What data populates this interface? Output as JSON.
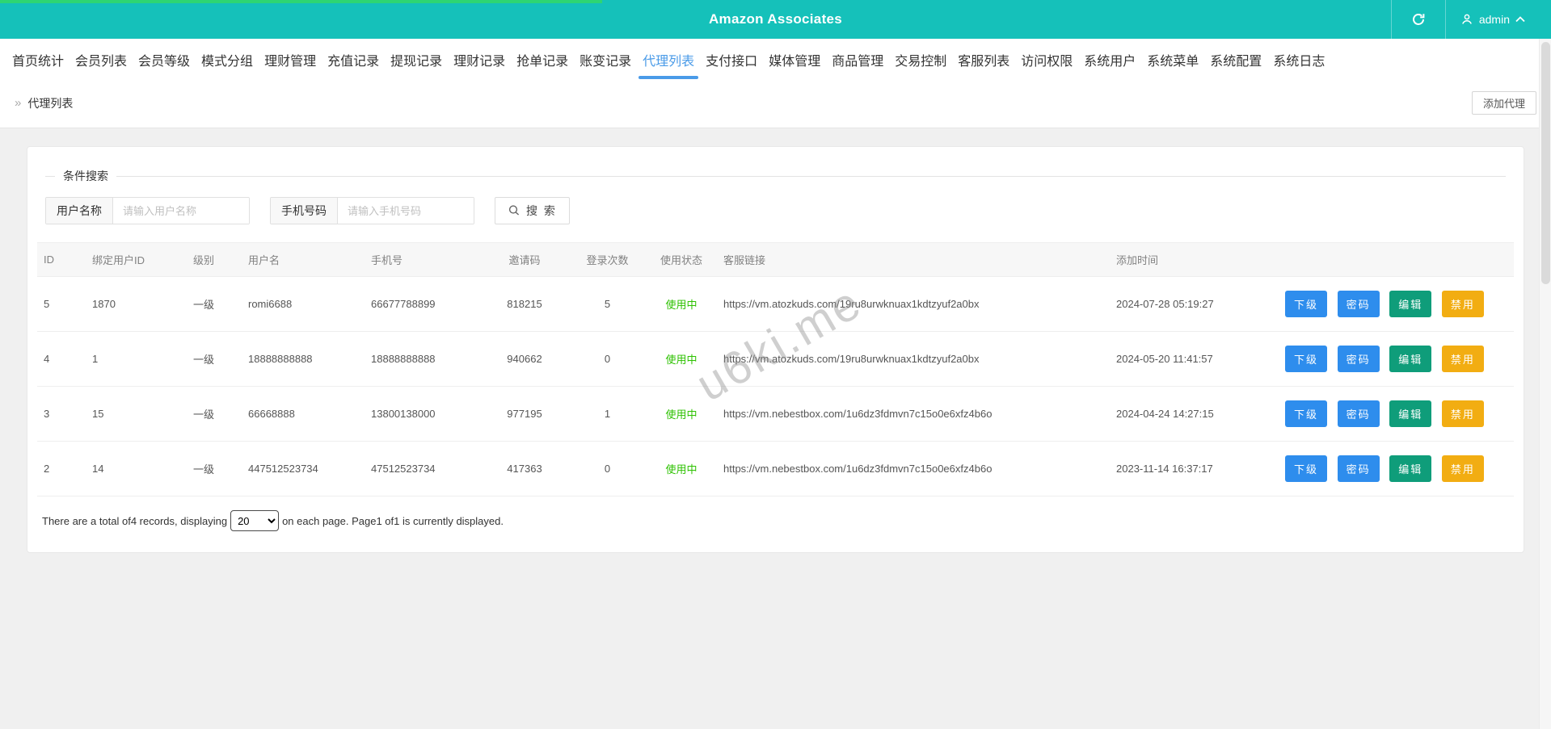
{
  "header": {
    "title": "Amazon Associates",
    "user": "admin"
  },
  "nav": {
    "items": [
      {
        "label": "首页统计",
        "active": false
      },
      {
        "label": "会员列表",
        "active": false
      },
      {
        "label": "会员等级",
        "active": false
      },
      {
        "label": "模式分组",
        "active": false
      },
      {
        "label": "理财管理",
        "active": false
      },
      {
        "label": "充值记录",
        "active": false
      },
      {
        "label": "提现记录",
        "active": false
      },
      {
        "label": "理财记录",
        "active": false
      },
      {
        "label": "抢单记录",
        "active": false
      },
      {
        "label": "账变记录",
        "active": false
      },
      {
        "label": "代理列表",
        "active": true
      },
      {
        "label": "支付接口",
        "active": false
      },
      {
        "label": "媒体管理",
        "active": false
      },
      {
        "label": "商品管理",
        "active": false
      },
      {
        "label": "交易控制",
        "active": false
      },
      {
        "label": "客服列表",
        "active": false
      },
      {
        "label": "访问权限",
        "active": false
      },
      {
        "label": "系统用户",
        "active": false
      },
      {
        "label": "系统菜单",
        "active": false
      },
      {
        "label": "系统配置",
        "active": false
      },
      {
        "label": "系统日志",
        "active": false
      }
    ]
  },
  "breadcrumb": {
    "icon": "»",
    "title": "代理列表"
  },
  "toolbar": {
    "add_button": "添加代理"
  },
  "search": {
    "legend": "条件搜索",
    "username_label": "用户名称",
    "username_placeholder": "请输入用户名称",
    "phone_label": "手机号码",
    "phone_placeholder": "请输入手机号码",
    "search_button": "搜 索"
  },
  "table": {
    "headers": [
      "ID",
      "绑定用户ID",
      "级别",
      "用户名",
      "手机号",
      "邀请码",
      "登录次数",
      "使用状态",
      "客服链接",
      "添加时间",
      ""
    ],
    "actions": [
      "下级",
      "密码",
      "编辑",
      "禁用"
    ],
    "rows": [
      {
        "id": "5",
        "bind_user_id": "1870",
        "level": "一级",
        "username": "romi6688",
        "phone": "66677788899",
        "invite_code": "818215",
        "login_count": "5",
        "status": "使用中",
        "link": "https://vm.atozkuds.com/19ru8urwknuax1kdtzyuf2a0bx",
        "added_time": "2024-07-28 05:19:27"
      },
      {
        "id": "4",
        "bind_user_id": "1",
        "level": "一级",
        "username": "18888888888",
        "phone": "18888888888",
        "invite_code": "940662",
        "login_count": "0",
        "status": "使用中",
        "link": "https://vm.atozkuds.com/19ru8urwknuax1kdtzyuf2a0bx",
        "added_time": "2024-05-20 11:41:57"
      },
      {
        "id": "3",
        "bind_user_id": "15",
        "level": "一级",
        "username": "66668888",
        "phone": "13800138000",
        "invite_code": "977195",
        "login_count": "1",
        "status": "使用中",
        "link": "https://vm.nebestbox.com/1u6dz3fdmvn7c15o0e6xfz4b6o",
        "added_time": "2024-04-24 14:27:15"
      },
      {
        "id": "2",
        "bind_user_id": "14",
        "level": "一级",
        "username": "447512523734",
        "phone": "47512523734",
        "invite_code": "417363",
        "login_count": "0",
        "status": "使用中",
        "link": "https://vm.nebestbox.com/1u6dz3fdmvn7c15o0e6xfz4b6o",
        "added_time": "2023-11-14 16:37:17"
      }
    ]
  },
  "pagination": {
    "prefix": "There are a total of4 records, displaying",
    "page_size": "20",
    "suffix": "on each page. Page1 of1 is currently displayed."
  },
  "watermark": "u6ki.me",
  "colors": {
    "header-bg": "#15c1ba",
    "progress": "#2ed573",
    "nav-active": "#4a9be8",
    "status": "#2dc100",
    "btn-blue": "#2e8ded",
    "btn-green": "#0f9d7a",
    "btn-yellow": "#f2ad12"
  }
}
